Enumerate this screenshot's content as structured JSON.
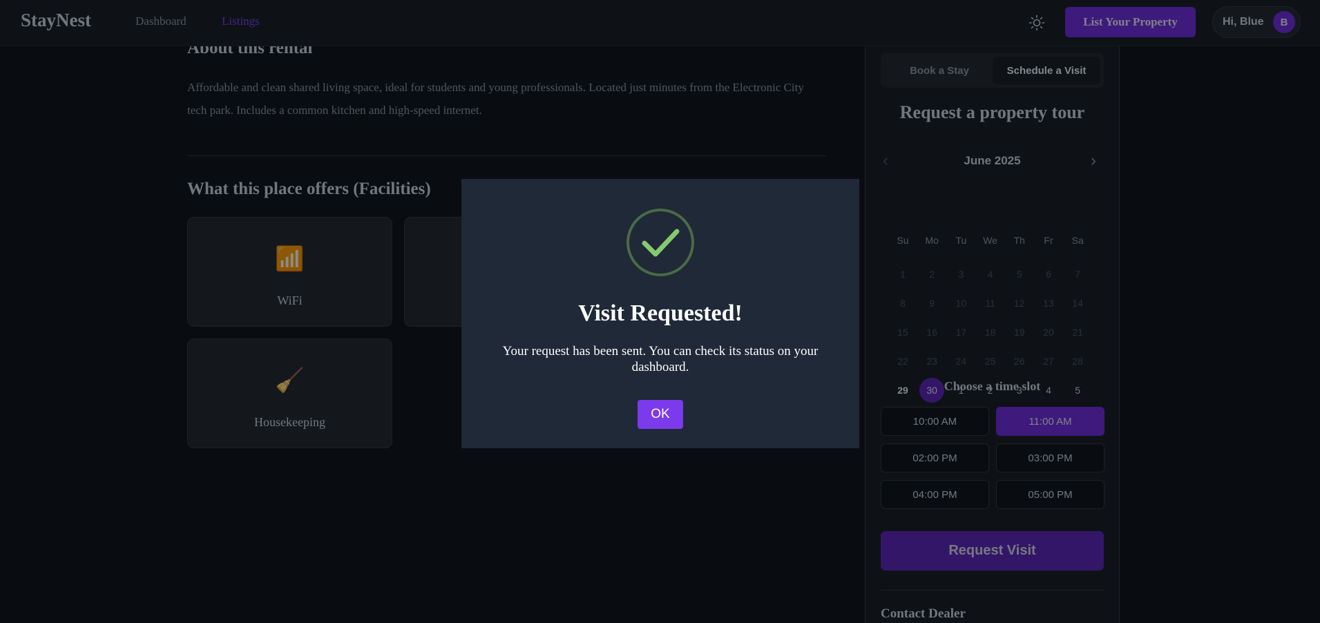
{
  "header": {
    "brand": "StayNest",
    "nav": [
      "Dashboard",
      "Listings"
    ],
    "active_nav": "Listings",
    "list_property_label": "List Your Property",
    "greeting": "Hi, Blue",
    "avatar_initial": "B",
    "theme_icon": "sun-icon"
  },
  "main": {
    "about_title": "About this rental",
    "about_text": "Affordable and clean shared living space, ideal for students and young professionals. Located just minutes from the Electronic City tech park. Includes a common kitchen and high-speed internet.",
    "facilities_title": "What this place offers (Facilities)",
    "facilities": [
      {
        "label": "WiFi",
        "icon": "signal-bars-icon",
        "glyph": "📶"
      },
      {
        "label": "",
        "icon": "",
        "glyph": ""
      },
      {
        "label": "Housekeeping",
        "icon": "broom-icon",
        "glyph": "🧹"
      }
    ]
  },
  "sidebar": {
    "tabs": [
      "Book a Stay",
      "Schedule a Visit"
    ],
    "active_tab": "Schedule a Visit",
    "title": "Request a property tour",
    "calendar": {
      "month": "June 2025",
      "weekdays": [
        "Su",
        "Mo",
        "Tu",
        "We",
        "Th",
        "Fr",
        "Sa"
      ],
      "weeks": [
        [
          "1",
          "2",
          "3",
          "4",
          "5",
          "6",
          "7"
        ],
        [
          "8",
          "9",
          "10",
          "11",
          "12",
          "13",
          "14"
        ],
        [
          "15",
          "16",
          "17",
          "18",
          "19",
          "20",
          "21"
        ],
        [
          "22",
          "23",
          "24",
          "25",
          "26",
          "27",
          "28"
        ],
        [
          "29",
          "30",
          "1",
          "2",
          "3",
          "4",
          "5"
        ]
      ],
      "today": "29",
      "selected": "30"
    },
    "time_slot_title": "Choose a time slot",
    "time_slots": [
      "10:00 AM",
      "11:00 AM",
      "02:00 PM",
      "03:00 PM",
      "04:00 PM",
      "05:00 PM"
    ],
    "selected_slot": "11:00 AM",
    "request_button": "Request Visit",
    "contact_title": "Contact Dealer"
  },
  "modal": {
    "icon": "check-circle-icon",
    "title": "Visit Requested!",
    "message": "Your request has been sent. You can check its status on your dashboard.",
    "ok_label": "OK"
  },
  "colors": {
    "accent": "#6d28d9",
    "accent_bright": "#7c3aed",
    "success": "#86c96e",
    "background": "#0d1117"
  }
}
